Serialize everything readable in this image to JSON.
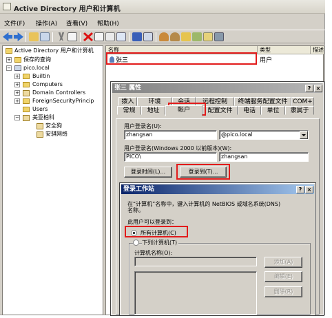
{
  "app": {
    "title": "Active Directory 用户和计算机"
  },
  "menu": [
    "文件(F)",
    "操作(A)",
    "查看(V)",
    "帮助(H)"
  ],
  "tree": {
    "root": "Active Directory 用户和计算机",
    "saved_queries": "保存的查询",
    "domain": "pico.local",
    "children": [
      "Builtin",
      "Computers",
      "Domain Controllers",
      "ForeignSecurityPrincip",
      "Users",
      "美亚柏科"
    ],
    "sub": [
      "安全狗",
      "安骐网络"
    ]
  },
  "list": {
    "columns": [
      "名称",
      "类型",
      "描述"
    ],
    "rows": [
      {
        "name": "张三",
        "type": "用户"
      }
    ]
  },
  "props": {
    "title": "张三 属性",
    "tabs_row1": [
      "拨入",
      "环境",
      "会话",
      "远程控制",
      "终端服务配置文件",
      "COM+"
    ],
    "tabs_row2": [
      "常规",
      "地址",
      "帐户",
      "配置文件",
      "电话",
      "单位",
      "隶属于"
    ],
    "logon_name_label": "用户登录名(U):",
    "logon_name": "zhangsan",
    "upn_suffix": "@pico.local",
    "pre2000_label": "用户登录名(Windows 2000 以前版本)(W):",
    "pre2000_domain": "PICO\\",
    "pre2000_name": "zhangsan",
    "logon_hours_btn": "登录时间(L)...",
    "logon_to_btn": "登录到(T)..."
  },
  "ws": {
    "title": "登录工作站",
    "desc1": "在“计算机”名称中，键入计算机的 NetBIOS 或域名系统(DNS)",
    "desc2": "名称。",
    "can_logon_label": "此用户可以登录到：",
    "opt_all": "所有计算机(C)",
    "opt_following": "下列计算机(T)",
    "computer_name_label": "计算机名称(O):",
    "add_btn": "添加(A)",
    "edit_btn": "编辑(E)",
    "remove_btn": "删除(R)"
  },
  "colors": {
    "highlight": "#e21b1b",
    "active_title": "#0a246a",
    "inactive_title": "#848484"
  }
}
